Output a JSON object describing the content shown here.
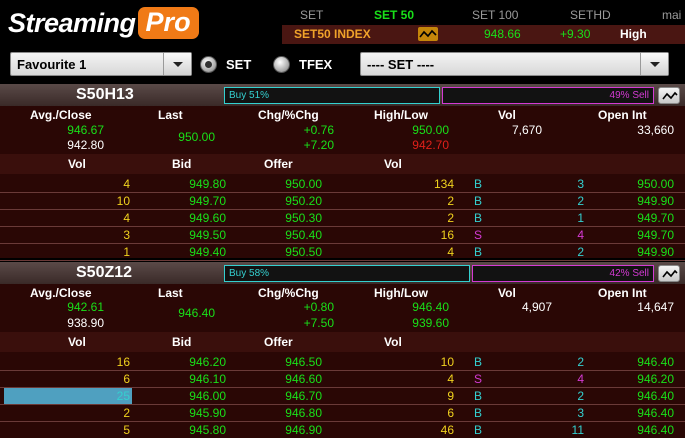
{
  "brand": {
    "word1": "Streaming",
    "word2": "Pro"
  },
  "market_tabs": [
    {
      "label": "SET",
      "active": false
    },
    {
      "label": "SET 50",
      "active": true
    },
    {
      "label": "SET 100",
      "active": false
    },
    {
      "label": "SETHD",
      "active": false
    },
    {
      "label": "mai",
      "active": false
    }
  ],
  "index": {
    "name": "SET50 INDEX",
    "value": "948.66",
    "change": "+9.30",
    "level": "High"
  },
  "controls": {
    "favourite": "Favourite 1",
    "radio_set": "SET",
    "radio_tfex": "TFEX",
    "market_select": "---- SET ----"
  },
  "colors": {
    "up": "#19e019",
    "buy": "#34d0d0",
    "sell": "#d43ad4",
    "accent": "#f07a16"
  },
  "labels": {
    "avg_close": "Avg./Close",
    "last": "Last",
    "chg": "Chg/%Chg",
    "high_low": "High/Low",
    "vol": "Vol",
    "open_int": "Open Int",
    "bid": "Bid",
    "offer": "Offer"
  },
  "panels": [
    {
      "symbol": "S50H13",
      "buy_pct": 0.51,
      "buy_label": "Buy  51%",
      "sell_pct": 0.49,
      "sell_label": "49%  Sell",
      "avg": "946.67",
      "close": "942.80",
      "last": "950.00",
      "chg": "+0.76",
      "pchg": "+7.20",
      "high": "950.00",
      "low": "942.70",
      "vol": "7,670",
      "open_int": "33,660",
      "depth": [
        {
          "bid_vol": "4",
          "bid": "949.80",
          "offer": "950.00",
          "offer_vol": "134",
          "side": "B",
          "tick_vol": "3",
          "tick_price": "950.00"
        },
        {
          "bid_vol": "10",
          "bid": "949.70",
          "offer": "950.20",
          "offer_vol": "2",
          "side": "B",
          "tick_vol": "2",
          "tick_price": "949.90"
        },
        {
          "bid_vol": "4",
          "bid": "949.60",
          "offer": "950.30",
          "offer_vol": "2",
          "side": "B",
          "tick_vol": "1",
          "tick_price": "949.70"
        },
        {
          "bid_vol": "3",
          "bid": "949.50",
          "offer": "950.40",
          "offer_vol": "16",
          "side": "S",
          "tick_vol": "4",
          "tick_price": "949.70"
        },
        {
          "bid_vol": "1",
          "bid": "949.40",
          "offer": "950.50",
          "offer_vol": "4",
          "side": "B",
          "tick_vol": "2",
          "tick_price": "949.90"
        }
      ]
    },
    {
      "symbol": "S50Z12",
      "buy_pct": 0.58,
      "buy_label": "Buy  58%",
      "sell_pct": 0.42,
      "sell_label": "42%  Sell",
      "avg": "942.61",
      "close": "938.90",
      "last": "946.40",
      "chg": "+0.80",
      "pchg": "+7.50",
      "high": "946.40",
      "low": "939.60",
      "vol": "4,907",
      "open_int": "14,647",
      "depth": [
        {
          "bid_vol": "16",
          "bid": "946.20",
          "offer": "946.50",
          "offer_vol": "10",
          "side": "B",
          "tick_vol": "2",
          "tick_price": "946.40"
        },
        {
          "bid_vol": "6",
          "bid": "946.10",
          "offer": "946.60",
          "offer_vol": "4",
          "side": "S",
          "tick_vol": "4",
          "tick_price": "946.20"
        },
        {
          "bid_vol": "25",
          "bid": "946.00",
          "offer": "946.70",
          "offer_vol": "9",
          "side": "B",
          "tick_vol": "2",
          "tick_price": "946.40",
          "highlight": true
        },
        {
          "bid_vol": "2",
          "bid": "945.90",
          "offer": "946.80",
          "offer_vol": "6",
          "side": "B",
          "tick_vol": "3",
          "tick_price": "946.40"
        },
        {
          "bid_vol": "5",
          "bid": "945.80",
          "offer": "946.90",
          "offer_vol": "46",
          "side": "B",
          "tick_vol": "11",
          "tick_price": "946.40"
        }
      ]
    }
  ]
}
